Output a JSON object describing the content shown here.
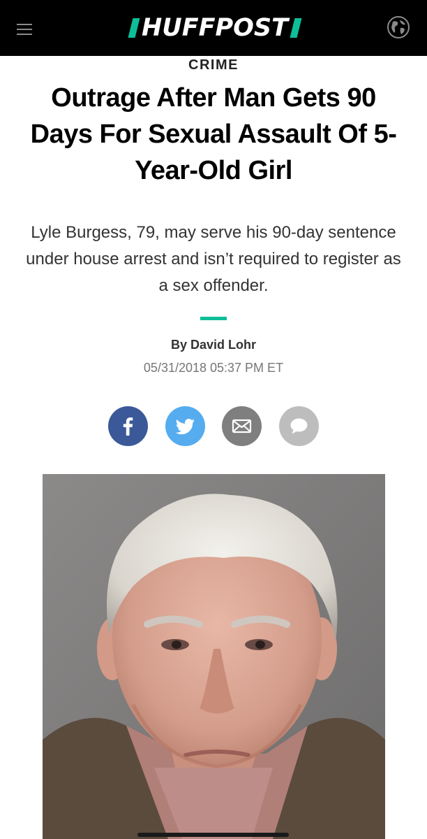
{
  "navbar": {
    "logo_text": "HUFFPOST",
    "menu_icon": "hamburger-menu-icon",
    "edition_icon": "globe-icon",
    "brand_color": "#0dbe98",
    "background": "#000000"
  },
  "article": {
    "section": "CRIME",
    "headline": "Outrage After Man Gets 90 Days For Sexual Assault Of 5-Year-Old Girl",
    "subheadline": "Lyle Burgess, 79, may serve his 90-day sentence under house arrest and isn’t required to register as a sex offender.",
    "byline": "By David Lohr",
    "timestamp": "05/31/2018 05:37 PM ET"
  },
  "share": {
    "buttons": [
      {
        "network": "facebook",
        "icon": "facebook-icon",
        "color": "#3b5998"
      },
      {
        "network": "twitter",
        "icon": "twitter-bird-icon",
        "color": "#55acee"
      },
      {
        "network": "email",
        "icon": "envelope-icon",
        "color": "#7f7f7f"
      },
      {
        "network": "comments",
        "icon": "speech-bubble-icon",
        "color": "#bdbdbd"
      }
    ]
  },
  "media": {
    "image": "mugshot-photo"
  }
}
